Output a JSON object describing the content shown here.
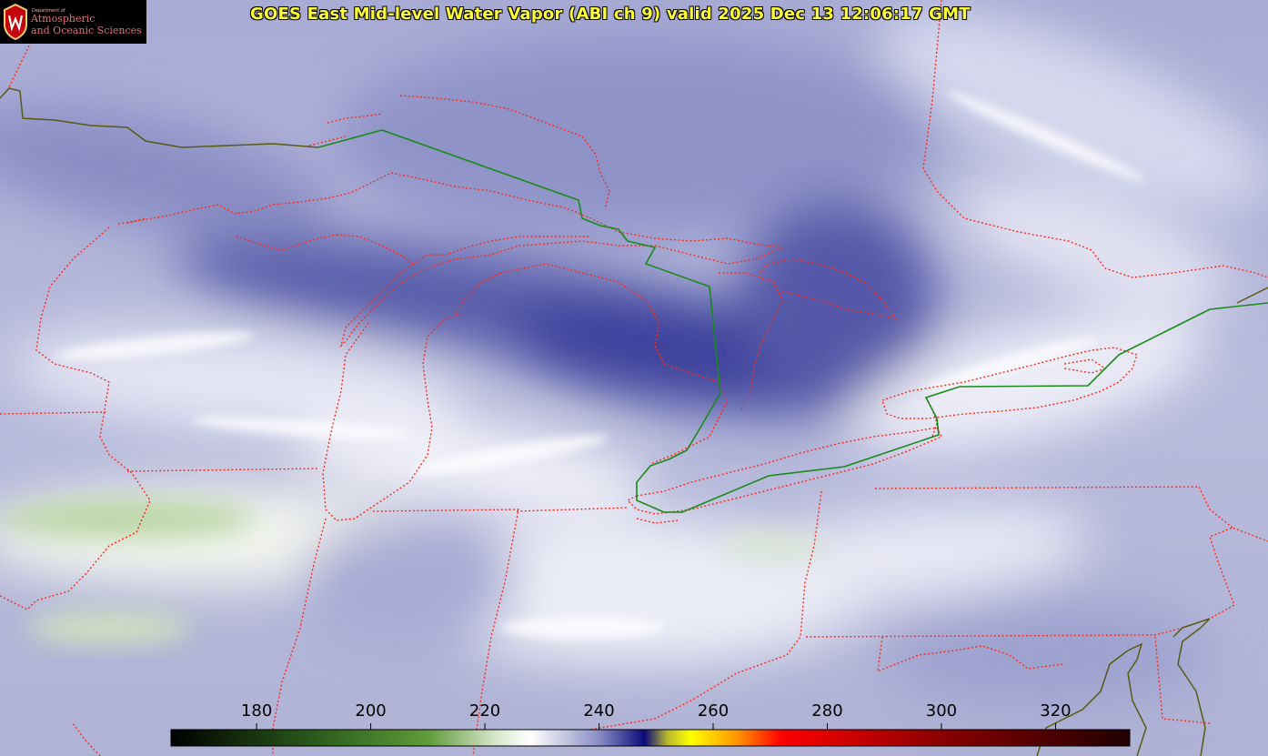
{
  "title": "GOES East Mid-level Water Vapor (ABI ch 9)  valid 2025 Dec 13 12:06:17 GMT",
  "logo": {
    "dept": "Department of",
    "line1": "Atmospheric",
    "line2": "and Oceanic Sciences",
    "seal_letter": "W"
  },
  "colorbar": {
    "ticks": [
      {
        "label": "180",
        "value": 180
      },
      {
        "label": "200",
        "value": 200
      },
      {
        "label": "220",
        "value": 220
      },
      {
        "label": "240",
        "value": 240
      },
      {
        "label": "260",
        "value": 260
      },
      {
        "label": "280",
        "value": 280
      },
      {
        "label": "300",
        "value": 300
      },
      {
        "label": "320",
        "value": 320
      }
    ],
    "range": [
      165,
      333
    ],
    "stops": [
      {
        "value": 165,
        "color": "#000000"
      },
      {
        "value": 190,
        "color": "#2a5a1a"
      },
      {
        "value": 210,
        "color": "#5f9a3a"
      },
      {
        "value": 222,
        "color": "#d8e8cc"
      },
      {
        "value": 228,
        "color": "#ffffff"
      },
      {
        "value": 240,
        "color": "#8a8ec4"
      },
      {
        "value": 248,
        "color": "#0a0a7a"
      },
      {
        "value": 252,
        "color": "#b8b830"
      },
      {
        "value": 256,
        "color": "#ffff00"
      },
      {
        "value": 264,
        "color": "#ff9900"
      },
      {
        "value": 272,
        "color": "#ff0000"
      },
      {
        "value": 300,
        "color": "#8a0000"
      },
      {
        "value": 333,
        "color": "#200000"
      }
    ]
  },
  "colors": {
    "state_border": "#ff2a1a",
    "intl_border": "#1a8a1a",
    "coast": "#5a5a10",
    "title": "#ffff33"
  }
}
